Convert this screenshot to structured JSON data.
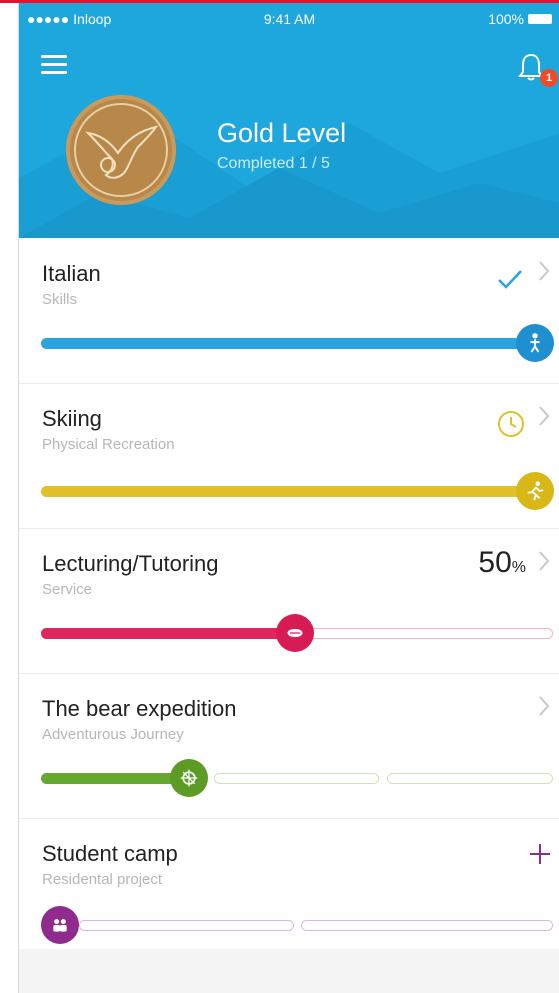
{
  "status_bar": {
    "carrier": "●●●●● Inloop",
    "time": "9:41 AM",
    "battery": "100%"
  },
  "header": {
    "level_title": "Gold Level",
    "level_progress": "Completed 1 / 5",
    "notification_count": "1"
  },
  "activities": [
    {
      "title": "Italian",
      "category": "Skills",
      "status": "completed",
      "progress": 1.0,
      "color": "#2aa3e0"
    },
    {
      "title": "Skiing",
      "category": "Physical Recreation",
      "status": "pending",
      "progress": 1.0,
      "color": "#e0c12a"
    },
    {
      "title": "Lecturing/Tutoring",
      "category": "Service",
      "status": "in-progress",
      "progress": 0.5,
      "percent": "50",
      "percent_unit": "%",
      "color": "#e0245e"
    },
    {
      "title": "The bear expedition",
      "category": "Adventurous Journey",
      "status": "in-progress",
      "progress": 0.3,
      "color": "#66a82f"
    },
    {
      "title": "Student camp",
      "category": "Residental project",
      "status": "not-started",
      "progress": 0.0,
      "color": "#8e2b8c"
    }
  ],
  "colors": {
    "header_blue": "#1ea7dc",
    "accent_red": "#e8102a"
  },
  "icons": [
    "menu-icon",
    "bell-icon",
    "check-icon",
    "clock-icon",
    "chevron-right-icon",
    "plus-icon",
    "medal-bird-icon"
  ]
}
